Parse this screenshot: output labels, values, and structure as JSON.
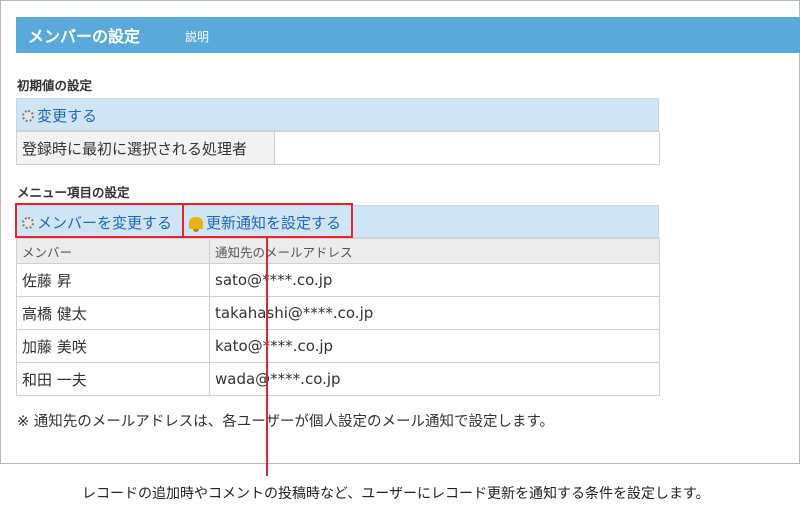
{
  "header": {
    "title": "メンバーの設定",
    "help_link": "説明"
  },
  "initial_settings": {
    "section_title": "初期値の設定",
    "change_link": "変更する",
    "row": {
      "label": "登録時に最初に選択される処理者",
      "value": ""
    }
  },
  "menu_settings": {
    "section_title": "メニュー項目の設定",
    "change_members_link": "メンバーを変更する",
    "notification_link": "更新通知を設定する",
    "columns": {
      "member": "メンバー",
      "email": "通知先のメールアドレス"
    },
    "rows": [
      {
        "name": "佐藤 昇",
        "email": "sato@****.co.jp"
      },
      {
        "name": "高橋 健太",
        "email": "takahashi@****.co.jp"
      },
      {
        "name": "加藤 美咲",
        "email": "kato@****.co.jp"
      },
      {
        "name": "和田 一夫",
        "email": "wada@****.co.jp"
      }
    ]
  },
  "note": "※ 通知先のメールアドレスは、各ユーザーが個人設定のメール通知で設定します。",
  "callout": "レコードの追加時やコメントの投稿時など、ユーザーにレコード更新を通知する条件を設定します。",
  "colors": {
    "header_bg": "#5aa9db",
    "bar_bg": "#cfe4f5",
    "link": "#2167b6",
    "highlight": "#e8242b"
  }
}
